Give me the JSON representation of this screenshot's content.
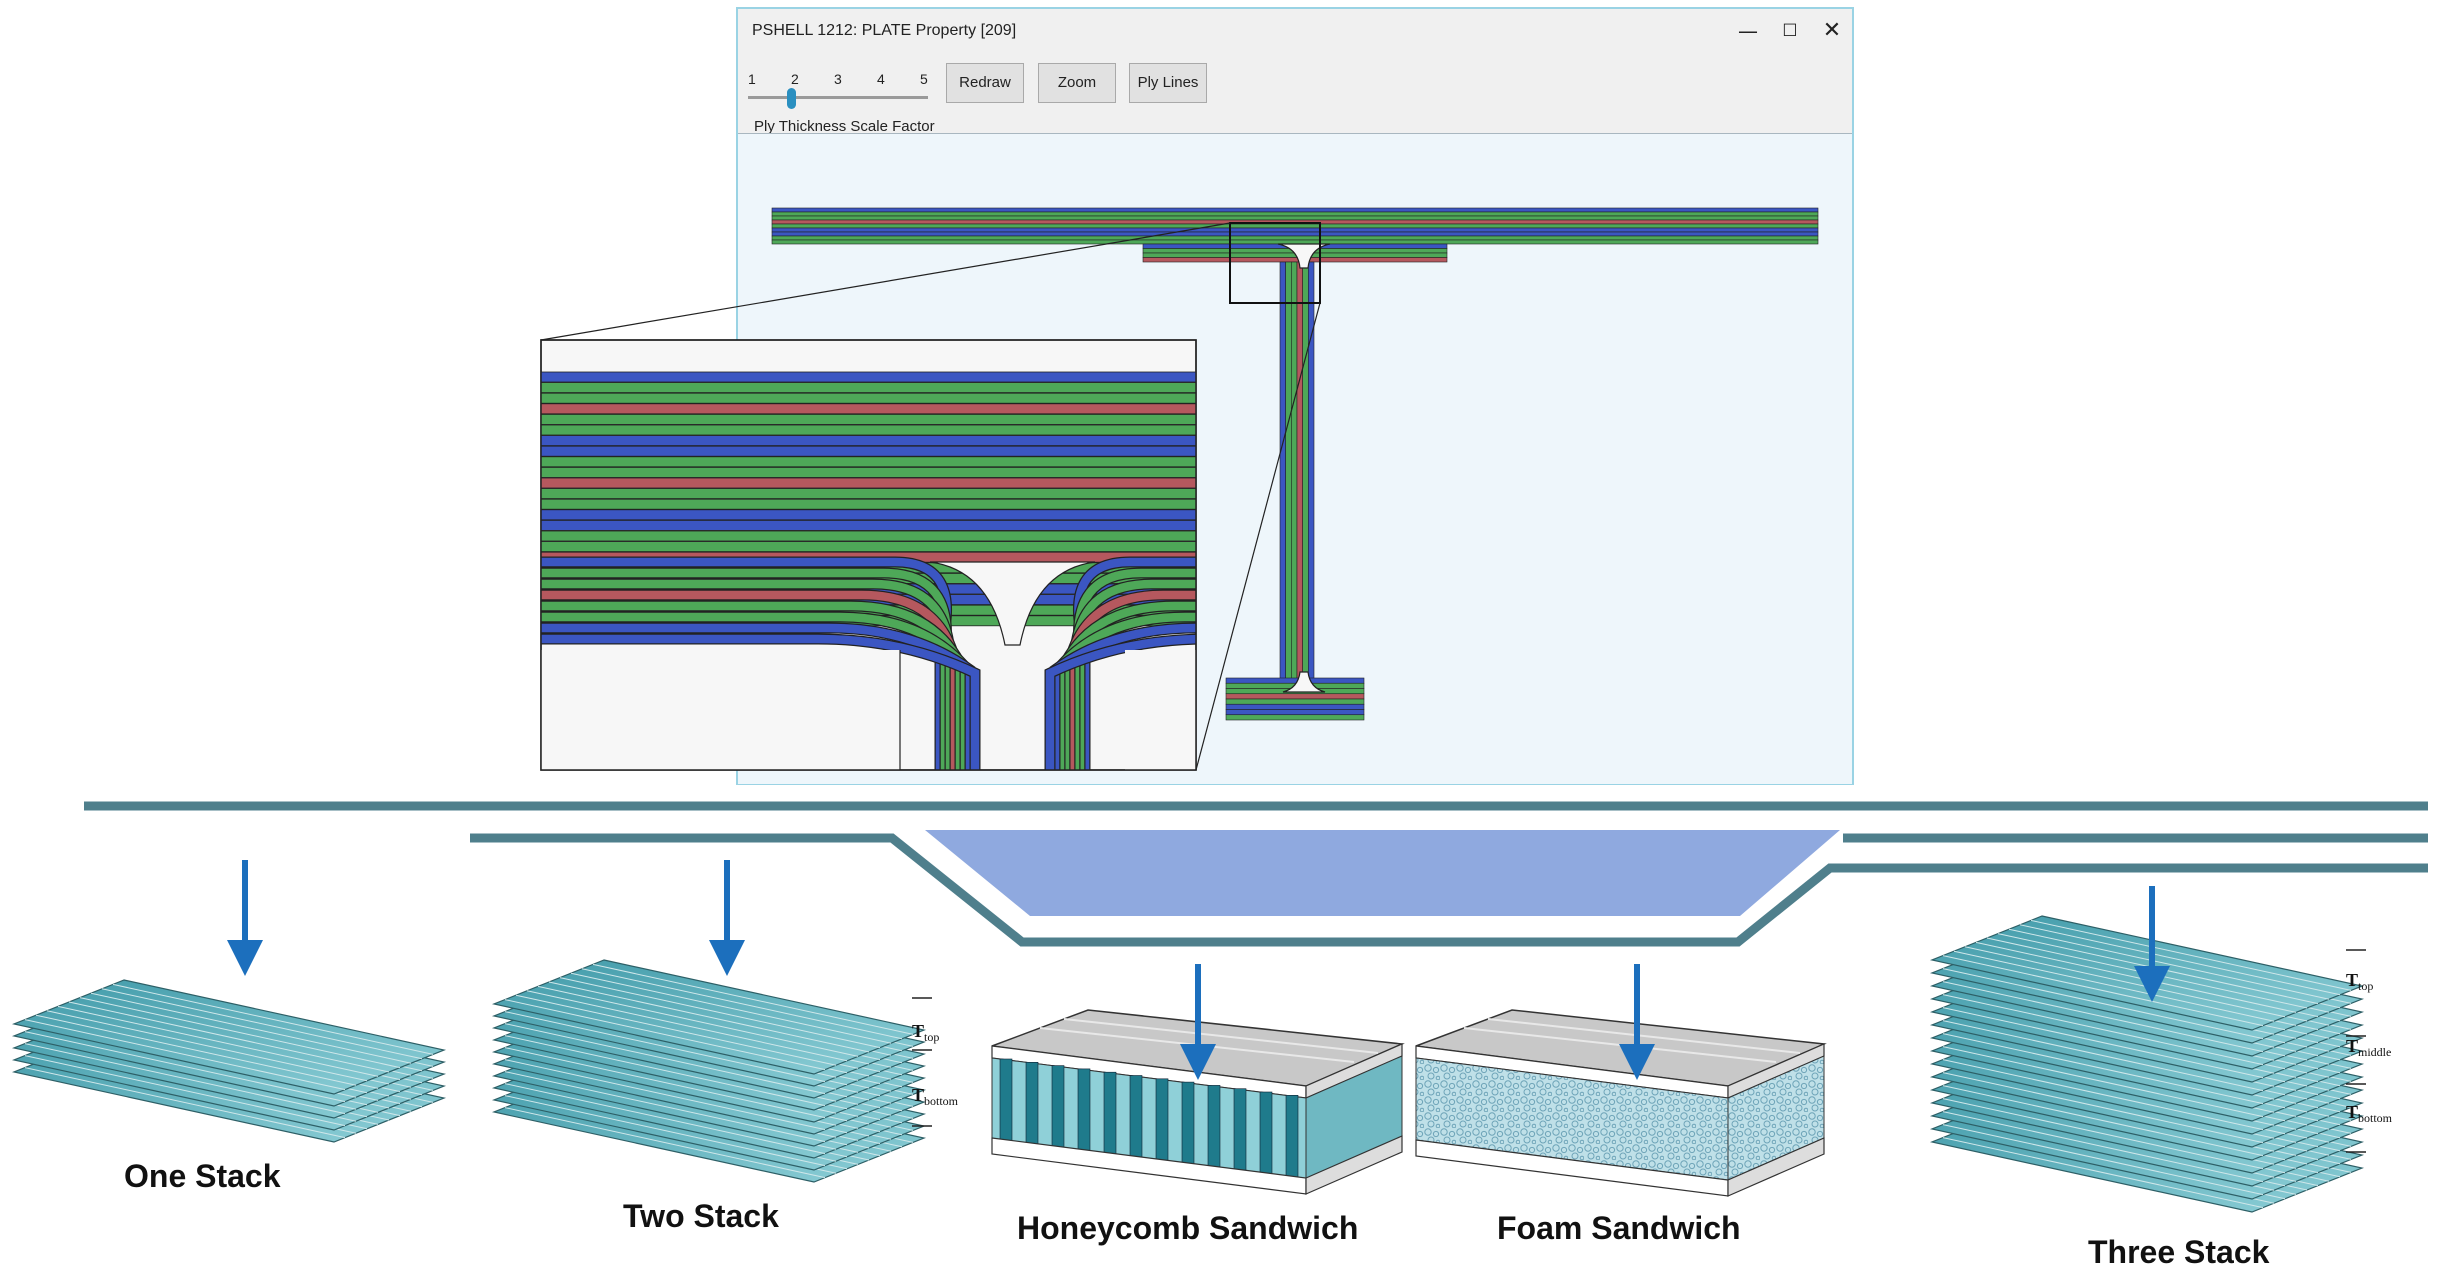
{
  "window": {
    "title": "PSHELL 1212: PLATE Property [209]",
    "controls": {
      "minimize": "—",
      "maximize": "☐",
      "close": "✕"
    }
  },
  "toolbar": {
    "slider_ticks": [
      "1",
      "2",
      "3",
      "4",
      "5"
    ],
    "slider_value": 2,
    "slider_caption": "Ply Thickness Scale Factor",
    "redraw_label": "Redraw",
    "zoom_label": "Zoom",
    "plylines_label": "Ply Lines"
  },
  "colors": {
    "ply_blue": "#3b56c2",
    "ply_green": "#4ea858",
    "ply_red": "#b5585e",
    "ply_teal": "#3c8a8a",
    "window_border": "#9ad3e4",
    "canvas_bg": "#eef6fb",
    "arrow": "#1c6fbd",
    "stack_plate": "#5fb0bd",
    "honeycomb_top": "#c8c8c8",
    "guide_line": "#4f7f8c",
    "guide_fill": "#8fa9df"
  },
  "stacks": {
    "one": {
      "label": "One Stack"
    },
    "two": {
      "label": "Two Stack",
      "t_top": "T",
      "t_top_sub": "top",
      "t_bottom": "T",
      "t_bottom_sub": "bottom"
    },
    "honeycomb": {
      "label": "Honeycomb Sandwich"
    },
    "foam": {
      "label": "Foam Sandwich"
    },
    "three": {
      "label": "Three Stack",
      "t_top": "T",
      "t_top_sub": "top",
      "t_middle": "T",
      "t_middle_sub": "middle",
      "t_bottom": "T",
      "t_bottom_sub": "bottom"
    }
  },
  "icons": [
    "minimize-icon",
    "maximize-icon",
    "close-icon",
    "down-arrow-icon"
  ]
}
